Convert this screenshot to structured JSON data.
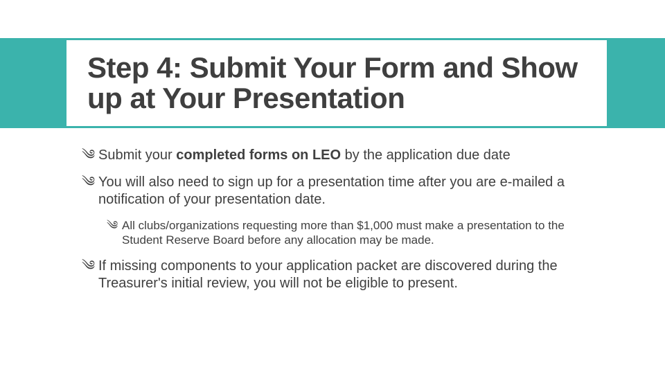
{
  "slide": {
    "title": "Step 4: Submit Your Form and Show up at Your Presentation",
    "bullets": [
      {
        "level": 1,
        "glyph": "༄",
        "text_pre": "Submit your ",
        "text_bold": "completed forms on LEO",
        "text_post": " by the application due date"
      },
      {
        "level": 1,
        "glyph": "༄",
        "text_pre": "You will also need to sign up for a presentation time after you are e-mailed a notification of your presentation date.",
        "text_bold": "",
        "text_post": ""
      },
      {
        "level": 2,
        "glyph": "༄",
        "text_pre": "All clubs/organizations requesting more than $1,000 must make a presentation to the Student Reserve Board before any allocation may be made.",
        "text_bold": "",
        "text_post": ""
      },
      {
        "level": 1,
        "glyph": "༄",
        "text_pre": "If missing components to your application packet are discovered during the Treasurer's initial review, you will not be eligible to present.",
        "text_bold": "",
        "text_post": ""
      }
    ]
  },
  "colors": {
    "teal": "#3bb3ac",
    "text": "#404040",
    "white": "#ffffff"
  }
}
